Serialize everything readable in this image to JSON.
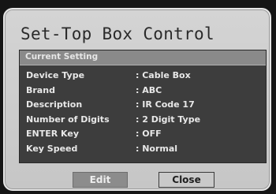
{
  "dialog": {
    "title": "Set-Top Box Control",
    "section_label": "Current Setting",
    "settings": [
      {
        "label": "Device Type",
        "value": ": Cable Box"
      },
      {
        "label": "Brand",
        "value": ": ABC"
      },
      {
        "label": "Description",
        "value": ": IR Code 17"
      },
      {
        "label": "Number of Digits",
        "value": ": 2 Digit Type"
      },
      {
        "label": "ENTER Key",
        "value": ": OFF"
      },
      {
        "label": "Key Speed",
        "value": ": Normal"
      }
    ],
    "buttons": {
      "edit": "Edit",
      "close": "Close"
    },
    "focused_button": "close"
  }
}
